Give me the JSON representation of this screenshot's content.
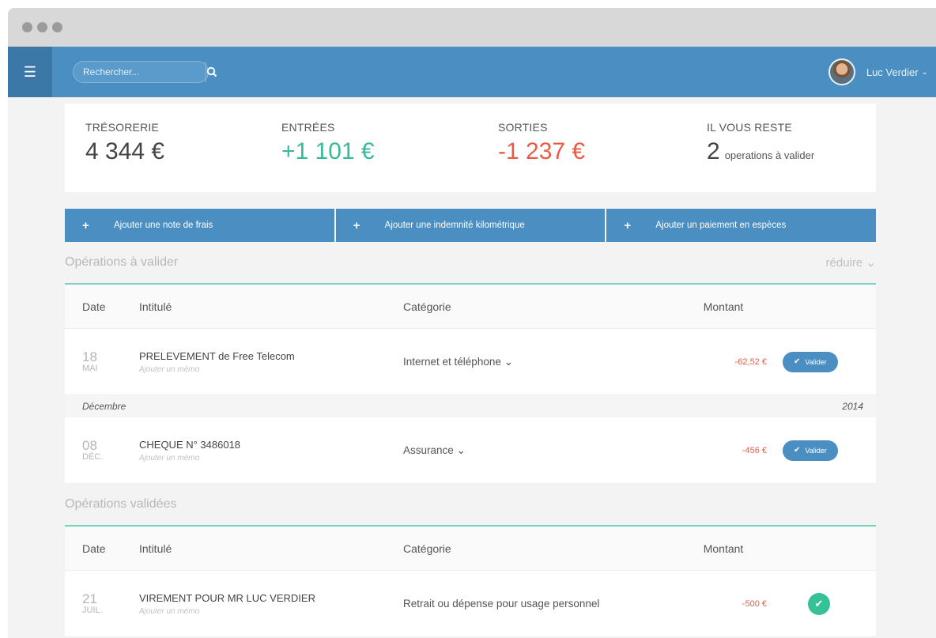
{
  "header": {
    "search_placeholder": "Rechercher...",
    "user_name": "Luc Verdier"
  },
  "summary": {
    "tresorerie_label": "TRÉSORERIE",
    "tresorerie_value": "4 344 €",
    "entrees_label": "ENTRÉES",
    "entrees_value": "+1 101 €",
    "sorties_label": "SORTIES",
    "sorties_value": "-1 237 €",
    "reste_label": "IL VOUS RESTE",
    "reste_count": "2",
    "reste_text": "operations à valider"
  },
  "actions": [
    {
      "label": "Ajouter une note de frais"
    },
    {
      "label": "Ajouter une indemnité kilométrique"
    },
    {
      "label": "Ajouter un paiement en espèces"
    }
  ],
  "pending": {
    "title": "Opérations à valider",
    "reduce_label": "réduire",
    "columns": {
      "date": "Date",
      "title": "Intitulé",
      "category": "Catégorie",
      "amount": "Montant"
    },
    "rows": [
      {
        "day": "18",
        "month": "MAI",
        "title": "PRELEVEMENT de Free Telecom",
        "memo": "Ajouter un mémo",
        "category": "Internet et téléphone",
        "amount": "-62,52 €",
        "action": "Valider"
      }
    ],
    "group": {
      "month": "Décembre",
      "year": "2014"
    },
    "group_rows": [
      {
        "day": "08",
        "month": "DÉC.",
        "title": "CHEQUE N° 3486018",
        "memo": "Ajouter un mémo",
        "category": "Assurance",
        "amount": "-456 €",
        "action": "Valider"
      }
    ]
  },
  "validated": {
    "title": "Opérations validées",
    "columns": {
      "date": "Date",
      "title": "Intitulé",
      "category": "Catégorie",
      "amount": "Montant"
    },
    "rows": [
      {
        "day": "21",
        "month": "JUIL.",
        "title": "VIREMENT POUR MR LUC VERDIER",
        "memo": "Ajouter un mémo",
        "category": "Retrait ou dépense pour usage personnel",
        "amount": "-500 €"
      }
    ]
  },
  "colors": {
    "primary": "#4a8ec2",
    "positive": "#3ab89a",
    "negative": "#e85c45",
    "validated": "#36c299"
  }
}
